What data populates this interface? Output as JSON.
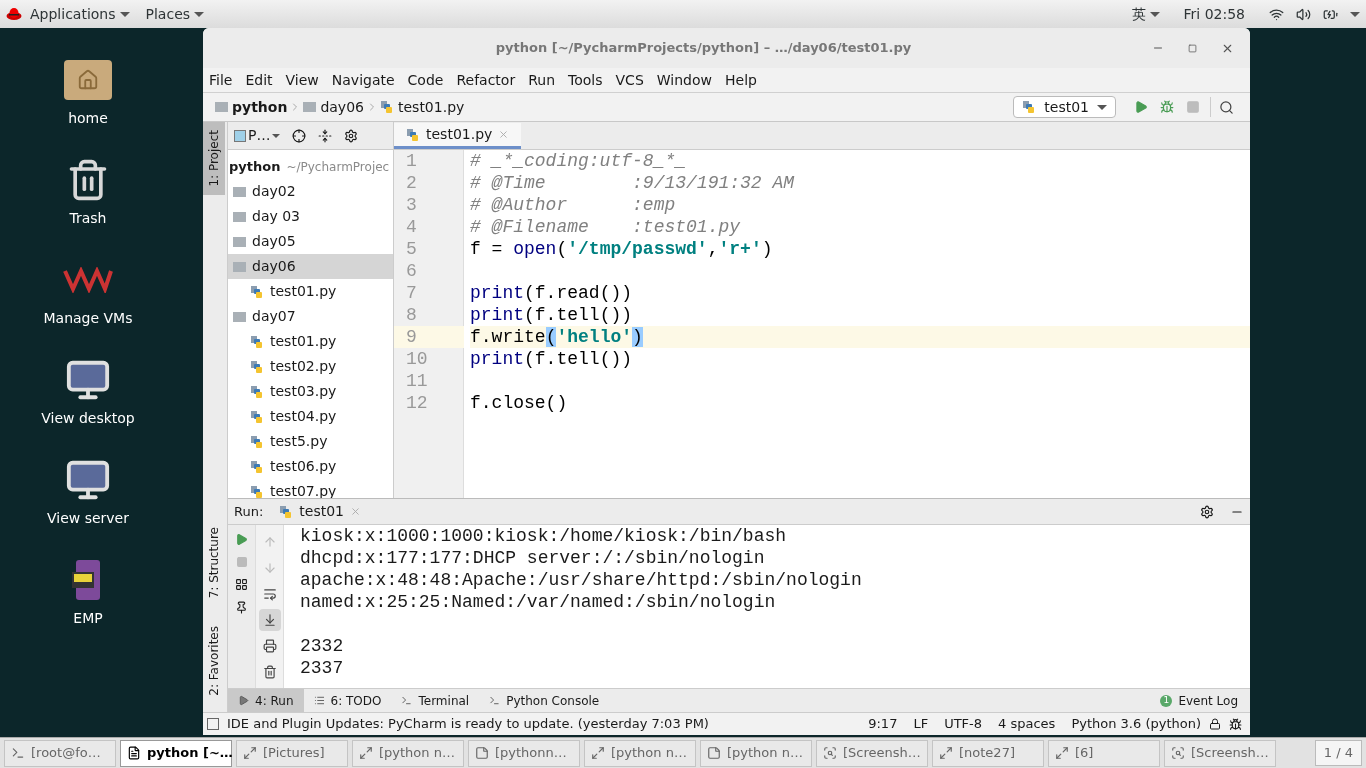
{
  "top_bar": {
    "menus": [
      {
        "label": "Applications"
      },
      {
        "label": "Places"
      }
    ],
    "input_method": "英",
    "clock": "Fri 02:58"
  },
  "desktop_icons": [
    {
      "label": "home",
      "kind": "home"
    },
    {
      "label": "Trash",
      "kind": "trash"
    },
    {
      "label": "Manage VMs",
      "kind": "vm"
    },
    {
      "label": "View desktop",
      "kind": "monitor"
    },
    {
      "label": "View server",
      "kind": "monitor"
    },
    {
      "label": "EMP",
      "kind": "app"
    }
  ],
  "window": {
    "title": "python [~/PycharmProjects/python] – …/day06/test01.py"
  },
  "menu": [
    "File",
    "Edit",
    "View",
    "Navigate",
    "Code",
    "Refactor",
    "Run",
    "Tools",
    "VCS",
    "Window",
    "Help"
  ],
  "breadcrumbs": [
    {
      "label": "python",
      "kind": "project"
    },
    {
      "label": "day06",
      "kind": "folder"
    },
    {
      "label": "test01.py",
      "kind": "file"
    }
  ],
  "toolbar": {
    "run_config": "test01",
    "buttons": [
      {
        "kind": "run",
        "disabled": false
      },
      {
        "kind": "debug",
        "disabled": false
      },
      {
        "kind": "stop",
        "disabled": true
      }
    ]
  },
  "side_tabs": {
    "top": [
      {
        "label": "1: Project",
        "selected": true
      }
    ],
    "bottom": [
      {
        "label": "7: Structure",
        "selected": false
      },
      {
        "label": "2: Favorites",
        "selected": false
      }
    ]
  },
  "project_panel": {
    "view": "P…",
    "root": {
      "name": "python",
      "path": "~/PycharmProjec",
      "selected": false,
      "children": [
        {
          "name": "day02",
          "kind": "folder",
          "selected": false
        },
        {
          "name": "day 03",
          "kind": "folder",
          "selected": false
        },
        {
          "name": "day05",
          "kind": "folder",
          "selected": false
        },
        {
          "name": "day06",
          "kind": "folder",
          "selected": true,
          "children": [
            {
              "name": "test01.py",
              "kind": "file",
              "selected": false
            }
          ]
        },
        {
          "name": "day07",
          "kind": "folder",
          "selected": false,
          "children": [
            {
              "name": "test01.py",
              "kind": "file",
              "selected": false
            },
            {
              "name": "test02.py",
              "kind": "file",
              "selected": false
            },
            {
              "name": "test03.py",
              "kind": "file",
              "selected": false
            },
            {
              "name": "test04.py",
              "kind": "file",
              "selected": false
            },
            {
              "name": "test5.py",
              "kind": "file",
              "selected": false
            },
            {
              "name": "test06.py",
              "kind": "file",
              "selected": false
            },
            {
              "name": "test07.py",
              "kind": "file",
              "selected": false
            }
          ]
        }
      ]
    }
  },
  "editor": {
    "tabs": [
      {
        "label": "test01.py",
        "selected": true
      }
    ],
    "lines": [
      {
        "number": "1",
        "current": false,
        "tokens": [
          {
            "kind": "comment",
            "text": "# _*_coding:utf-8_*_"
          }
        ]
      },
      {
        "number": "2",
        "current": false,
        "tokens": [
          {
            "kind": "comment",
            "text": "# @Time        :9/13/191:32 AM"
          }
        ]
      },
      {
        "number": "3",
        "current": false,
        "tokens": [
          {
            "kind": "comment",
            "text": "# @Author      :emp"
          }
        ]
      },
      {
        "number": "4",
        "current": false,
        "tokens": [
          {
            "kind": "comment",
            "text": "# @Filename    :test01.py"
          }
        ]
      },
      {
        "number": "5",
        "current": false,
        "tokens": [
          {
            "kind": "plain",
            "text": "f = "
          },
          {
            "kind": "builtin",
            "text": "open"
          },
          {
            "kind": "plain",
            "text": "("
          },
          {
            "kind": "string",
            "text": "'/tmp/passwd'"
          },
          {
            "kind": "plain",
            "text": ","
          },
          {
            "kind": "string",
            "text": "'r+'"
          },
          {
            "kind": "plain",
            "text": ")"
          }
        ]
      },
      {
        "number": "6",
        "current": false
      },
      {
        "number": "7",
        "current": false,
        "tokens": [
          {
            "kind": "builtin",
            "text": "print"
          },
          {
            "kind": "plain",
            "text": "(f.read())"
          }
        ]
      },
      {
        "number": "8",
        "current": false,
        "tokens": [
          {
            "kind": "builtin",
            "text": "print"
          },
          {
            "kind": "plain",
            "text": "(f.tell())"
          }
        ]
      },
      {
        "number": "9",
        "current": true,
        "tokens": [
          {
            "kind": "plain",
            "text": "f.write"
          },
          {
            "kind": "match",
            "text": "("
          },
          {
            "kind": "string",
            "text": "'hello'"
          },
          {
            "kind": "match",
            "text": ")"
          }
        ]
      },
      {
        "number": "10",
        "current": false,
        "tokens": [
          {
            "kind": "builtin",
            "text": "print"
          },
          {
            "kind": "plain",
            "text": "(f.tell())"
          }
        ]
      },
      {
        "number": "11",
        "current": false
      },
      {
        "number": "12",
        "current": false,
        "tokens": [
          {
            "kind": "plain",
            "text": "f.close()"
          }
        ]
      }
    ]
  },
  "run_panel": {
    "title": "Run:",
    "tab": "test01",
    "tools": [
      {
        "kind": "up",
        "disabled": true,
        "on": false
      },
      {
        "kind": "down",
        "disabled": true,
        "on": false
      },
      {
        "kind": "wrap",
        "disabled": false,
        "on": false
      },
      {
        "kind": "scroll-end",
        "disabled": false,
        "on": true
      },
      {
        "kind": "print",
        "disabled": false,
        "on": false
      },
      {
        "kind": "trash",
        "disabled": false,
        "on": false
      }
    ],
    "output": [
      {
        "lines": [
          "kiosk:x:1000:1000:kiosk:/home/kiosk:/bin/bash",
          "dhcpd:x:177:177:DHCP server:/:/sbin/nologin",
          "apache:x:48:48:Apache:/usr/share/httpd:/sbin/nologin",
          "named:x:25:25:Named:/var/named:/sbin/nologin"
        ]
      },
      {
        "lines": [
          "2332",
          "2337"
        ]
      }
    ]
  },
  "bottom_tabs": [
    {
      "label": "4: Run",
      "kind": "run",
      "selected": true
    },
    {
      "label": "6: TODO",
      "kind": "todo",
      "selected": false
    },
    {
      "label": "Terminal",
      "kind": "terminal",
      "selected": false
    },
    {
      "label": "Python Console",
      "kind": "console",
      "selected": false
    }
  ],
  "event_log": {
    "label": "Event Log",
    "count": "1"
  },
  "status_bar": {
    "message": "IDE and Plugin Updates: PyCharm is ready to update. (yesterday 7:03 PM)",
    "items": [
      "9:17",
      "LF",
      "UTF-8",
      "4 spaces",
      "Python 3.6 (python)"
    ]
  },
  "taskbar": {
    "items": [
      {
        "label": "[root@fo…",
        "kind": "terminal",
        "selected": false
      },
      {
        "label": "python [~…",
        "kind": "pycharm",
        "selected": true
      },
      {
        "label": "[Pictures]",
        "kind": "window",
        "selected": false
      },
      {
        "label": "[python n…",
        "kind": "window",
        "selected": false
      },
      {
        "label": "[pythonn…",
        "kind": "editor",
        "selected": false
      },
      {
        "label": "[python n…",
        "kind": "window",
        "selected": false
      },
      {
        "label": "[python n…",
        "kind": "editor",
        "selected": false
      },
      {
        "label": "[Screensh…",
        "kind": "screenshot",
        "selected": false
      },
      {
        "label": "[note27]",
        "kind": "window",
        "selected": false
      },
      {
        "label": "[6]",
        "kind": "window",
        "selected": false
      },
      {
        "label": "[Screensh…",
        "kind": "screenshot",
        "selected": false
      }
    ],
    "pager": "1 / 4"
  }
}
